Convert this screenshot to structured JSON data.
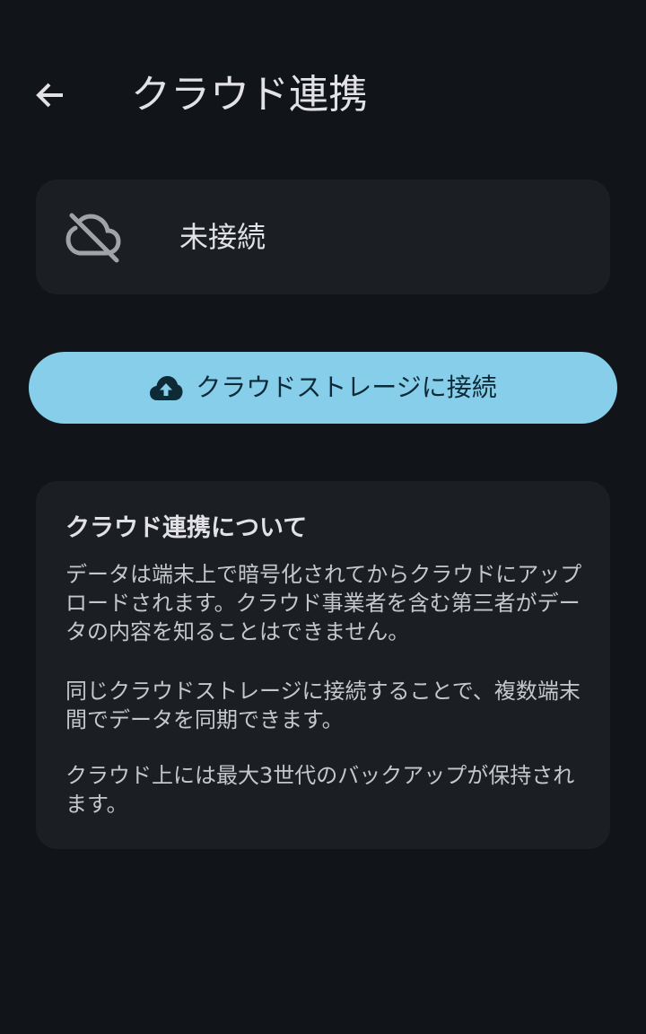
{
  "app_bar": {
    "title": "クラウド連携",
    "back_icon": "arrow-left-icon"
  },
  "status": {
    "icon": "cloud-off-icon",
    "text": "未接続"
  },
  "connect_button": {
    "icon": "cloud-upload-icon",
    "label": "クラウドストレージに接続"
  },
  "info": {
    "title": "クラウド連携について",
    "paragraphs": [
      "データは端末上で暗号化されてからクラウドにアップロードされます。クラウド事業者を含む第三者がデータの内容を知ることはできません。",
      "同じクラウドストレージに接続することで、複数端末間でデータを同期できます。",
      "クラウド上には最大3世代のバックアップが保持されます。"
    ]
  },
  "colors": {
    "background": "#111418",
    "card": "#1b1f23",
    "accent": "#87ceeb"
  }
}
